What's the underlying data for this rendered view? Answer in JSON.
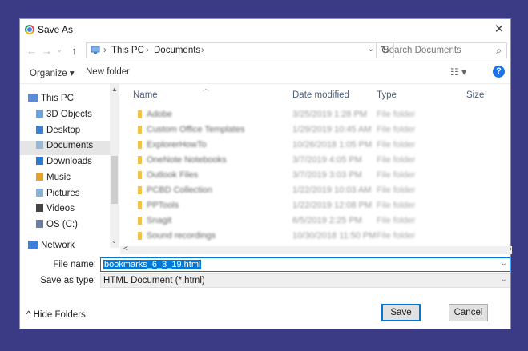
{
  "window": {
    "title": "Save As",
    "close_glyph": "✕"
  },
  "nav": {
    "back": "←",
    "forward": "→",
    "dropdown": "⌄",
    "up": "↑"
  },
  "address": {
    "crumbs": [
      "This PC",
      "Documents"
    ],
    "sep": "›",
    "refresh": "↻",
    "dropdown": "⌄"
  },
  "search": {
    "placeholder": "Search Documents",
    "icon": "⌕"
  },
  "toolbar": {
    "organize": "Organize ▾",
    "new_folder": "New folder",
    "view": "☷ ▾",
    "help": "?"
  },
  "tree": {
    "items": [
      {
        "label": "This PC",
        "icon": "computer-icon",
        "color": "#5b8bd6"
      },
      {
        "label": "3D Objects",
        "icon": "cube-icon",
        "color": "#6aa3e0"
      },
      {
        "label": "Desktop",
        "icon": "desktop-icon",
        "color": "#3d7fd1"
      },
      {
        "label": "Documents",
        "icon": "documents-icon",
        "color": "#9bb7d8"
      },
      {
        "label": "Downloads",
        "icon": "download-icon",
        "color": "#2a7ad5"
      },
      {
        "label": "Music",
        "icon": "music-icon",
        "color": "#e5a12a"
      },
      {
        "label": "Pictures",
        "icon": "pictures-icon",
        "color": "#8ab1da"
      },
      {
        "label": "Videos",
        "icon": "videos-icon",
        "color": "#444"
      },
      {
        "label": "OS (C:)",
        "icon": "drive-icon",
        "color": "#6b7fa3"
      },
      {
        "label": "Network",
        "icon": "network-icon",
        "color": "#3b7dd8"
      }
    ],
    "selected": "Documents"
  },
  "columns": {
    "name": "Name",
    "date": "Date modified",
    "type": "Type",
    "size": "Size"
  },
  "files": [
    {
      "name": "Adobe",
      "date": "3/25/2019 1:28 PM",
      "type": "File folder"
    },
    {
      "name": "Custom Office Templates",
      "date": "1/29/2019 10:45 AM",
      "type": "File folder"
    },
    {
      "name": "ExplorerHowTo",
      "date": "10/26/2018 1:05 PM",
      "type": "File folder"
    },
    {
      "name": "OneNote Notebooks",
      "date": "3/7/2019 4:05 PM",
      "type": "File folder"
    },
    {
      "name": "Outlook Files",
      "date": "3/7/2019 3:03 PM",
      "type": "File folder"
    },
    {
      "name": "PCBD Collection",
      "date": "1/22/2019 10:03 AM",
      "type": "File folder"
    },
    {
      "name": "PPTools",
      "date": "1/22/2019 12:08 PM",
      "type": "File folder"
    },
    {
      "name": "Snagit",
      "date": "6/5/2019 2:25 PM",
      "type": "File folder"
    },
    {
      "name": "Sound recordings",
      "date": "10/30/2018 11:50 PM",
      "type": "File folder"
    }
  ],
  "form": {
    "file_name_label": "File name:",
    "file_name_value": "bookmarks_6_8_19.html",
    "save_type_label": "Save as type:",
    "save_type_value": "HTML Document (*.html)",
    "dropdown": "⌄"
  },
  "footer": {
    "hide_folders": "^  Hide Folders",
    "save": "Save",
    "cancel": "Cancel"
  },
  "scroll": {
    "up": "▲",
    "down": "▼",
    "left": "<",
    "right": "›",
    "network_chev": "⌄"
  }
}
